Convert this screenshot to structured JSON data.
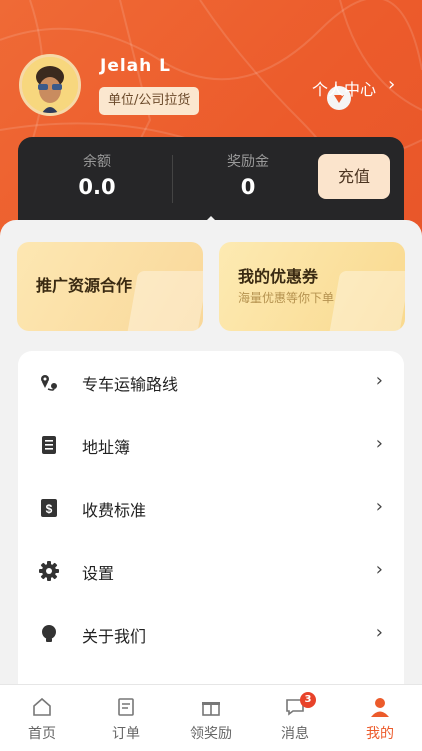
{
  "user": {
    "name": "Jelah L",
    "role": "单位/公司拉货"
  },
  "header": {
    "personal_center": "个人中心"
  },
  "wallet": {
    "balance_label": "余额",
    "balance_value": "0.0",
    "bonus_label": "奖励金",
    "bonus_value": "0",
    "topup_label": "充值"
  },
  "promos": [
    {
      "title": "推广资源合作"
    },
    {
      "title": "我的优惠券",
      "subtitle": "海量优惠等你下单"
    }
  ],
  "menu": [
    {
      "label": "专车运输路线",
      "icon": "route-icon"
    },
    {
      "label": "地址簿",
      "icon": "address-book-icon"
    },
    {
      "label": "收费标准",
      "icon": "price-tag-icon"
    },
    {
      "label": "设置",
      "icon": "gear-icon"
    },
    {
      "label": "关于我们",
      "icon": "lightbulb-icon"
    }
  ],
  "tabs": [
    {
      "label": "首页",
      "icon": "home-icon"
    },
    {
      "label": "订单",
      "icon": "orders-icon"
    },
    {
      "label": "领奖励",
      "icon": "gift-icon"
    },
    {
      "label": "消息",
      "icon": "message-icon",
      "badge": "3"
    },
    {
      "label": "我的",
      "icon": "person-icon",
      "active": true
    }
  ],
  "colors": {
    "accent": "#ec5b2b",
    "card_dark": "#262628",
    "gold": "#fbe4cc"
  }
}
